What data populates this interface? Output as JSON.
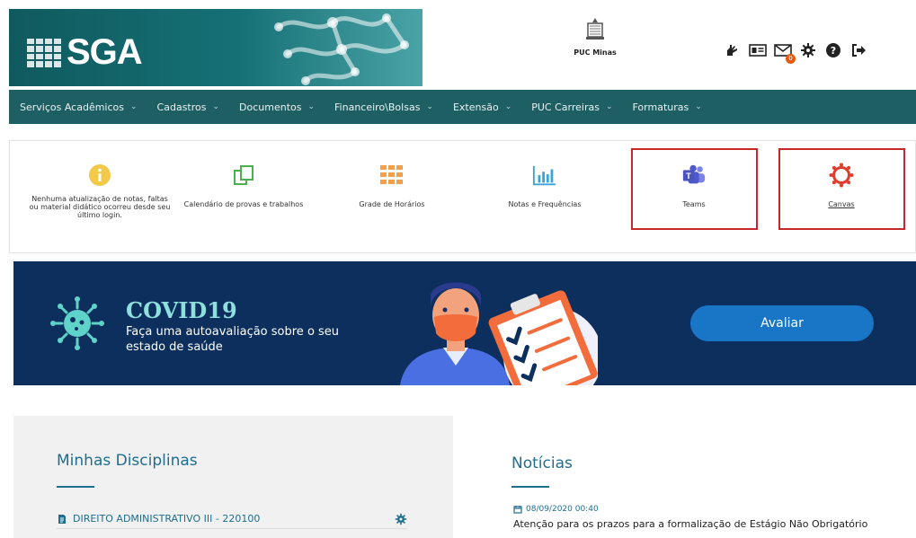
{
  "app": {
    "logo_text": "SGA",
    "institution": "PUC Minas"
  },
  "header_icons": [
    {
      "icon": "sign-language-icon"
    },
    {
      "icon": "id-card-icon"
    },
    {
      "icon": "mail-icon",
      "badge": "0"
    },
    {
      "icon": "gear-icon"
    },
    {
      "icon": "help-icon"
    },
    {
      "icon": "logout-icon"
    }
  ],
  "nav": [
    "Serviços Acadêmicos",
    "Cadastros",
    "Documentos",
    "Financeiro\\Bolsas",
    "Extensão",
    "PUC Carreiras",
    "Formaturas"
  ],
  "quick_links": [
    {
      "icon": "info-icon",
      "label": "Nenhuma atualização de notas, faltas ou material didático ocorreu desde seu último login."
    },
    {
      "icon": "copy-icon",
      "label": "Calendário de provas e trabalhos"
    },
    {
      "icon": "grid-icon",
      "label": "Grade de Horários"
    },
    {
      "icon": "bar-chart-icon",
      "label": "Notas e Frequências"
    },
    {
      "icon": "teams-icon",
      "label": "Teams"
    },
    {
      "icon": "canvas-icon",
      "label": "Canvas"
    }
  ],
  "banner": {
    "title": "COVID19",
    "subtitle": "Faça uma autoavaliação sobre o seu estado de saúde",
    "button": "Avaliar"
  },
  "disciplinas": {
    "title": "Minhas Disciplinas",
    "items": [
      {
        "name": "DIREITO ADMINISTRATIVO III - 220100"
      }
    ]
  },
  "noticias": {
    "title": "Notícias",
    "items": [
      {
        "date": "08/09/2020 00:40",
        "text": "Atenção para os prazos para a formalização de Estágio Não Obrigatório"
      }
    ]
  },
  "colors": {
    "nav_bg": "#1e5f63",
    "banner_bg": "#0d2f5e",
    "accent_blue": "#1976c7",
    "highlight_frame": "#c62828"
  }
}
